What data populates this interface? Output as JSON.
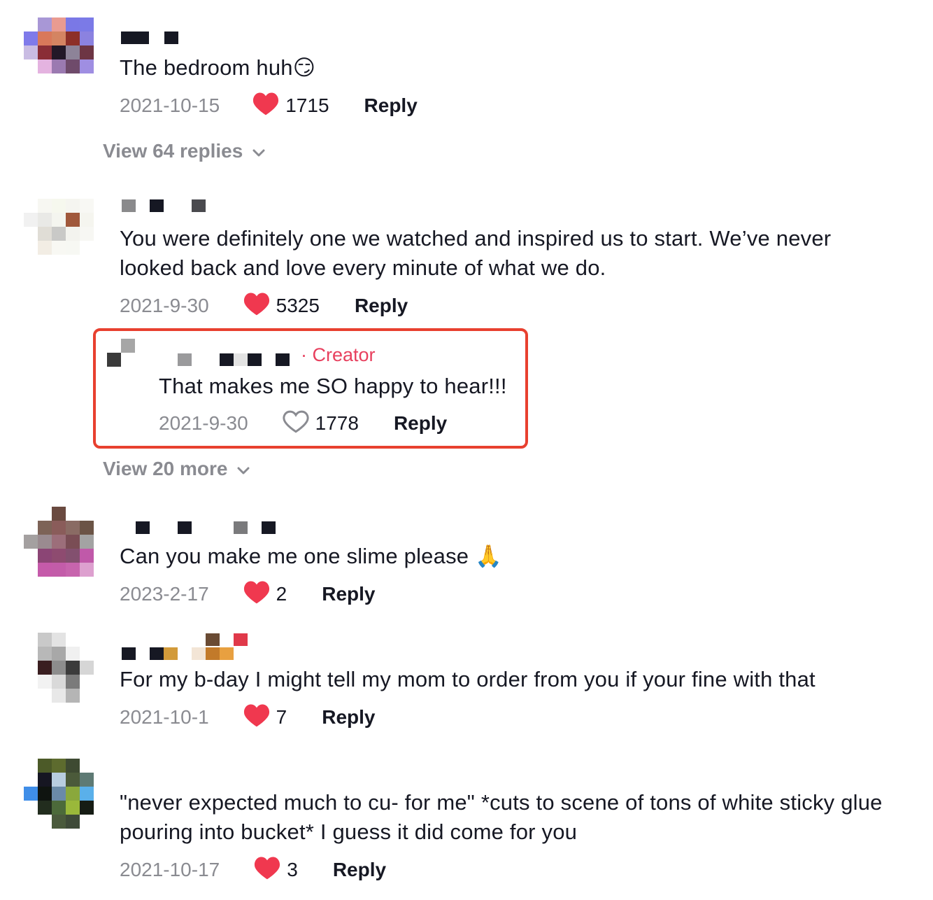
{
  "colors": {
    "heart": "#f0384f",
    "highlight_border": "#e8402f",
    "creator": "#e8405e",
    "muted": "#8a8b91"
  },
  "comments": [
    {
      "text": "The bedroom huh😏",
      "date": "2021-10-15",
      "likes": "1715",
      "liked": true,
      "reply_label": "Reply",
      "view_replies": "View 64 replies"
    },
    {
      "text": "You were definitely one we watched and inspired us to start. We’ve never looked back and love every minute of what we do.",
      "date": "2021-9-30",
      "likes": "5325",
      "liked": true,
      "reply_label": "Reply",
      "creator_reply": {
        "badge": "· Creator",
        "text": "That makes me SO happy to hear!!!",
        "date": "2021-9-30",
        "likes": "1778",
        "liked": false,
        "reply_label": "Reply"
      },
      "view_more": "View 20 more"
    },
    {
      "text": "Can you make me one slime please 🙏",
      "date": "2023-2-17",
      "likes": "2",
      "liked": true,
      "reply_label": "Reply"
    },
    {
      "text": "For my b-day I might tell my mom to order from you if your fine with that",
      "date": "2021-10-1",
      "likes": "7",
      "liked": true,
      "reply_label": "Reply"
    },
    {
      "text": "\"never expected much to cu- for me\" *cuts to scene of tons of white sticky glue pouring into bucket* I guess it did come for you",
      "date": "2021-10-17",
      "likes": "3",
      "liked": true,
      "reply_label": "Reply"
    }
  ]
}
